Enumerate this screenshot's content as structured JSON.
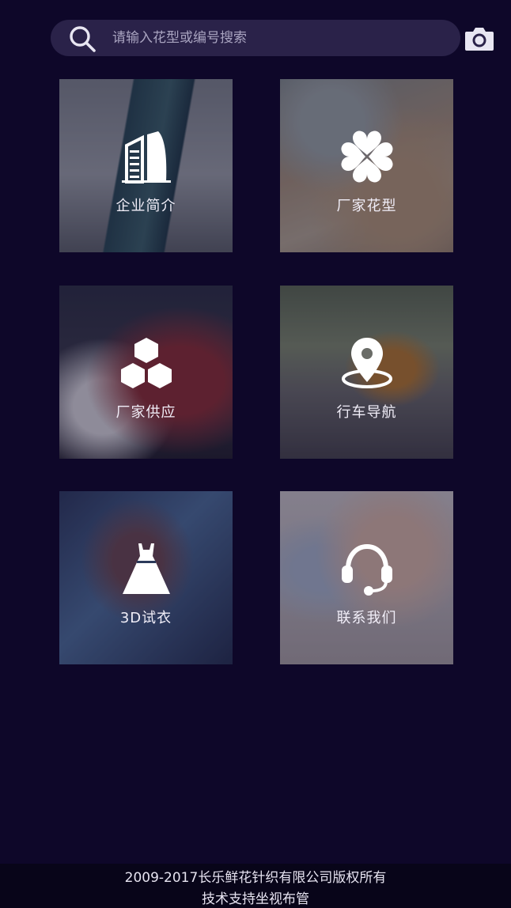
{
  "search": {
    "placeholder": "请输入花型或编号搜索",
    "search_icon": "search-icon",
    "camera_icon": "camera-icon"
  },
  "tiles": [
    {
      "label": "企业简介",
      "icon": "building-icon"
    },
    {
      "label": "厂家花型",
      "icon": "clover-icon"
    },
    {
      "label": "厂家供应",
      "icon": "hexagons-icon"
    },
    {
      "label": "行车导航",
      "icon": "location-pin-icon"
    },
    {
      "label": "3D试衣",
      "icon": "dress-icon"
    },
    {
      "label": "联系我们",
      "icon": "headset-icon"
    }
  ],
  "footer": {
    "copyright": "2009-2017长乐鲜花针织有限公司版权所有",
    "support": "技术支持坐视布管"
  },
  "colors": {
    "background": "#0e0729",
    "search_bar": "#2a2249",
    "footer": "#080519"
  }
}
